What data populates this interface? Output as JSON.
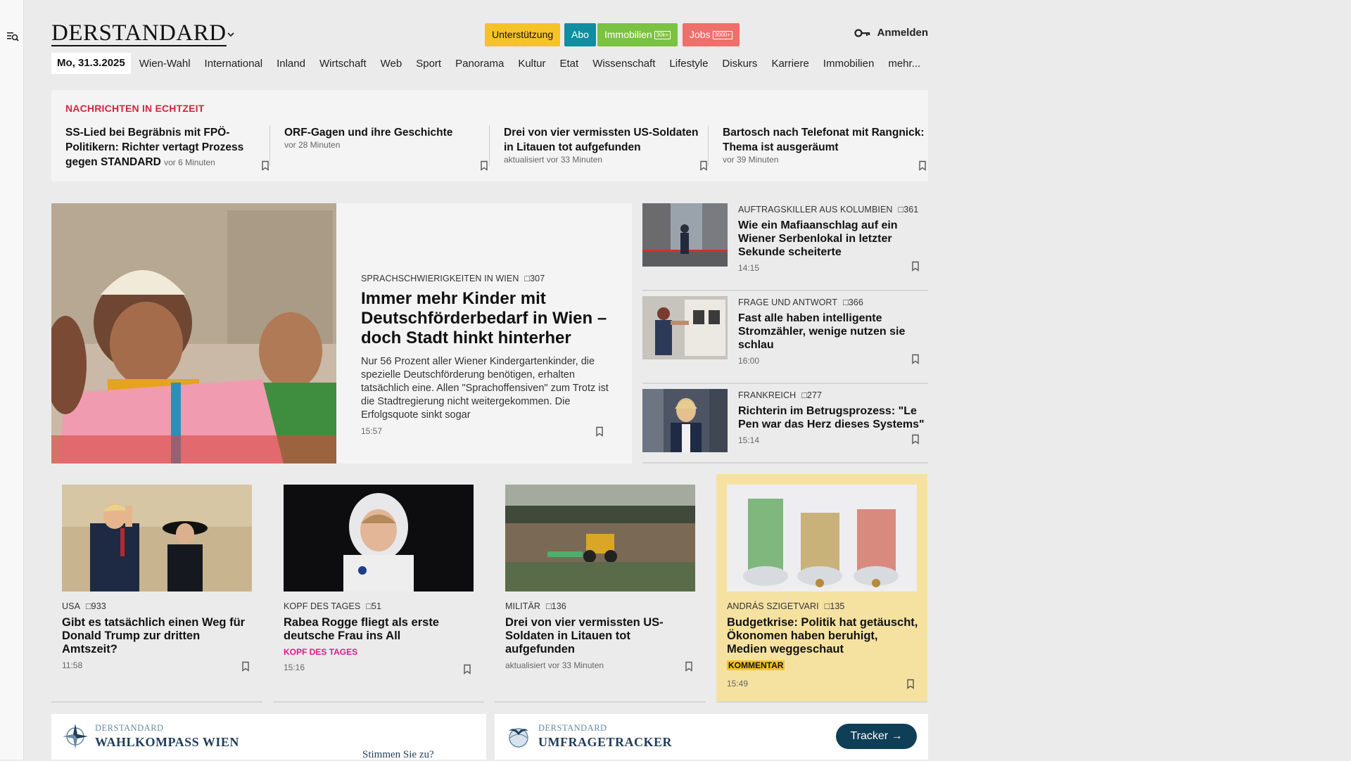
{
  "header": {
    "logo": "DERSTANDARD",
    "promos": [
      {
        "label": "Unterstützung",
        "color": "#f5c328",
        "text_color": "#111111"
      },
      {
        "label": "Abo",
        "color": "#0e8ea0",
        "text_color": "#ffffff"
      },
      {
        "label": "Immobilien",
        "tag": "30k+",
        "color": "#7cc242",
        "text_color": "#ffffff"
      },
      {
        "label": "Jobs",
        "tag": "3000+",
        "color": "#ef6f6a",
        "text_color": "#ffffff"
      }
    ],
    "login": "Anmelden"
  },
  "nav": {
    "date": "Mo, 31.3.2025",
    "items": [
      "Wien-Wahl",
      "International",
      "Inland",
      "Wirtschaft",
      "Web",
      "Sport",
      "Panorama",
      "Kultur",
      "Etat",
      "Wissenschaft",
      "Lifestyle",
      "Diskurs",
      "Karriere",
      "Immobilien",
      "mehr..."
    ]
  },
  "ticker": {
    "heading": "NACHRICHTEN IN ECHTZEIT",
    "items": [
      {
        "title": "SS-Lied bei Begräbnis mit FPÖ-Politikern: Richter vertagt Prozess gegen STANDARD",
        "meta": "vor 6 Minuten"
      },
      {
        "title": "ORF-Gagen und ihre Geschichte",
        "meta": "vor 28 Minuten"
      },
      {
        "title": "Drei von vier vermissten US-Soldaten in Litauen tot aufgefunden",
        "meta": "aktualisiert vor 33 Minuten"
      },
      {
        "title": "Bartosch nach Telefonat mit Rangnick: Thema ist ausgeräumt",
        "meta": "vor 39 Minuten"
      }
    ]
  },
  "hero": {
    "kicker": "SPRACHSCHWIERIGKEITEN IN WIEN",
    "comments": "307",
    "title": "Immer mehr Kinder mit Deutschförderbedarf in Wien – doch Stadt hinkt hinterher",
    "lead": "Nur 56 Prozent aller Wiener Kindergartenkinder, die spezielle Deutschförderung benötigen, erhalten tatsächlich eine. Allen \"Sprachoffensiven\" zum Trotz ist die Stadtregierung nicht weitergekommen. Die Erfolgsquote sinkt sogar",
    "time": "15:57"
  },
  "side": [
    {
      "kicker": "AUFTRAGSKILLER AUS KOLUMBIEN",
      "comments": "361",
      "title": "Wie ein Mafiaanschlag auf ein Wiener Serbenlokal in letzter Sekunde scheiterte",
      "time": "14:15"
    },
    {
      "kicker": "FRAGE UND ANTWORT",
      "comments": "366",
      "title": "Fast alle haben intelligente Stromzähler, wenige nutzen sie schlau",
      "time": "16:00"
    },
    {
      "kicker": "FRANKREICH",
      "comments": "277",
      "title": "Richterin im Betrugsprozess: \"Le Pen war das Herz dieses Systems\"",
      "time": "15:14"
    }
  ],
  "cards": [
    {
      "kicker": "USA",
      "comments": "933",
      "title": "Gibt es tatsächlich einen Weg für Donald Trump zur dritten Amtszeit?",
      "badge": "",
      "time": "11:58"
    },
    {
      "kicker": "KOPF DES TAGES",
      "comments": "51",
      "title": "Rabea Rogge fliegt als erste deutsche Frau ins All",
      "badge": "KOPF DES TAGES",
      "time": "15:16"
    },
    {
      "kicker": "MILITÄR",
      "comments": "136",
      "title": "Drei von vier vermissten US-Soldaten in Litauen tot aufgefunden",
      "badge": "",
      "time": "aktualisiert vor 33 Minuten"
    },
    {
      "kicker": "ANDRÁS SZIGETVARI",
      "comments": "135",
      "title": "Budgetkrise: Politik hat getäuscht, Ökonomen haben beruhigt, Medien weggeschaut",
      "badge": "KOMMENTAR",
      "time": "15:49"
    }
  ],
  "widgets": {
    "wahlkompass": {
      "brand": "DERSTANDARD",
      "title": "WAHLKOMPASS WIEN",
      "cta": "Stimmen Sie zu?"
    },
    "umfrage": {
      "brand": "DERSTANDARD",
      "title": "UMFRAGETRACKER",
      "button": "Tracker"
    }
  },
  "colors": {
    "ticker_heading": "#d1283b",
    "kopf_badge": "#e0178a",
    "kommentar_badge": "#f5c328",
    "tracker_button": "#0f3e57"
  }
}
